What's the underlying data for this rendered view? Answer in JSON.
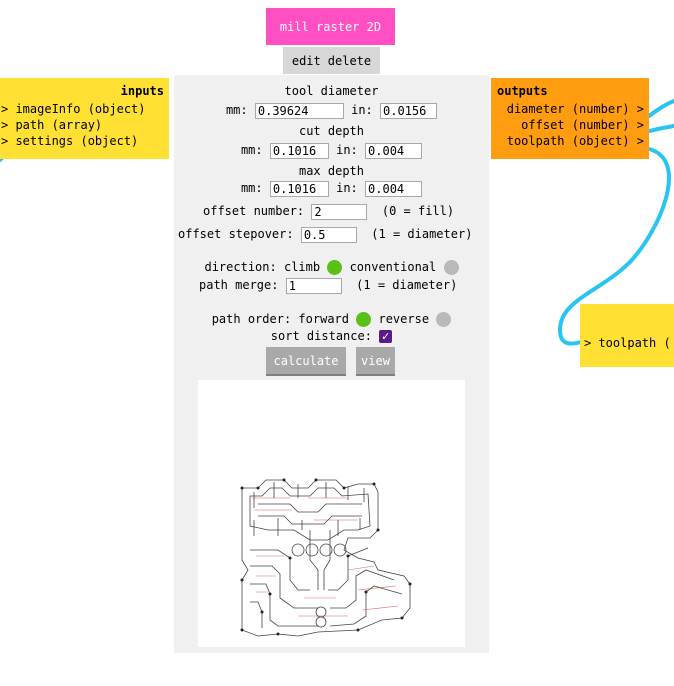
{
  "module": {
    "title": "mill raster 2D",
    "edit_label": "edit",
    "delete_label": "delete"
  },
  "inputs": {
    "header": "inputs",
    "ports": [
      "> imageInfo (object)",
      "> path (array)",
      "> settings (object)"
    ]
  },
  "outputs": {
    "header": "outputs",
    "ports": [
      "diameter (number) >",
      "offset (number) >",
      "toolpath (object) >"
    ]
  },
  "controls": {
    "tool_diameter_label": "tool diameter",
    "mm_label": "mm:",
    "in_label": "in:",
    "tool_diameter_mm": "0.39624",
    "tool_diameter_in": "0.0156",
    "cut_depth_label": "cut depth",
    "cut_depth_mm": "0.1016",
    "cut_depth_in": "0.004",
    "max_depth_label": "max depth",
    "max_depth_mm": "0.1016",
    "max_depth_in": "0.004",
    "offset_number_label": "offset number:",
    "offset_number": "2",
    "offset_number_hint": "(0 = fill)",
    "offset_stepover_label": "offset stepover:",
    "offset_stepover": "0.5",
    "offset_stepover_hint": "(1 = diameter)",
    "direction_label": "direction:",
    "direction_climb": "climb",
    "direction_conventional": "conventional",
    "path_merge_label": "path merge:",
    "path_merge": "1",
    "path_merge_hint": "(1 = diameter)",
    "path_order_label": "path order:",
    "path_order_forward": "forward",
    "path_order_reverse": "reverse",
    "sort_distance_label": "sort distance:",
    "sort_distance_checked": true,
    "calculate_label": "calculate",
    "view_label": "view"
  },
  "downstream": {
    "port": "> toolpath ("
  },
  "colors": {
    "title": "#ff4fc3",
    "inputs": "#ffe033",
    "outputs": "#ff9c10",
    "wire": "#29c5f0",
    "selected_radio": "#5bbf1a",
    "unselected_radio": "#b9b9b9",
    "checkbox": "#5a1a8a"
  }
}
